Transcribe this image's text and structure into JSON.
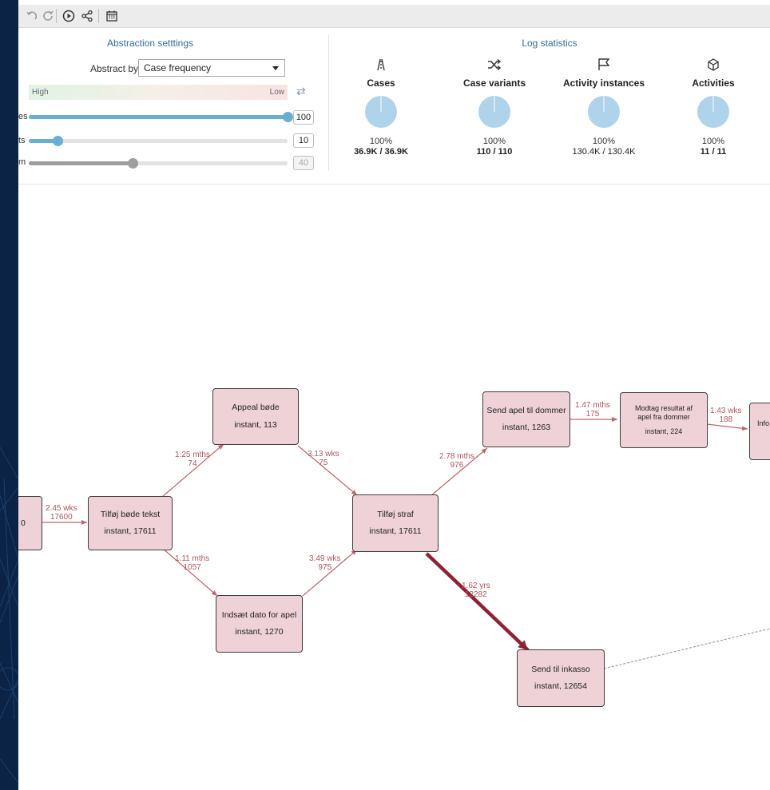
{
  "toolbar": {
    "icons": [
      "undo-icon",
      "redo-icon",
      "play-icon",
      "share-icon",
      "calendar-icon"
    ]
  },
  "abstraction": {
    "title": "Abstraction setttings",
    "abstract_by_label": "Abstract by",
    "abstract_by_value": "Case frequency",
    "high_label": "High",
    "low_label": "Low",
    "sliders": [
      {
        "label_fragment": "es",
        "value": "100",
        "level": 1.0,
        "color": "#6aaed0",
        "disabled": false
      },
      {
        "label_fragment": "ts",
        "value": "10",
        "level": 0.11,
        "color": "#6aaed0",
        "disabled": false
      },
      {
        "label_fragment": "m",
        "value": "40",
        "level": 0.4,
        "color": "#9e9e9e",
        "disabled": true
      }
    ]
  },
  "log_statistics": {
    "title": "Log statistics",
    "items": [
      {
        "icon": "road-icon",
        "label": "Cases",
        "percent": "100%",
        "count": "36.9K / 36.9K",
        "bold": true
      },
      {
        "icon": "shuffle-icon",
        "label": "Case variants",
        "percent": "100%",
        "count": "110 / 110",
        "bold": true
      },
      {
        "icon": "flag-icon",
        "label": "Activity instances",
        "percent": "100%",
        "count": "130.4K / 130.4K",
        "bold": false
      },
      {
        "icon": "cube-icon",
        "label": "Activities",
        "percent": "100%",
        "count": "11 / 11",
        "bold": true
      }
    ],
    "pie_color": "#afd3ea"
  },
  "graph": {
    "nodes": [
      {
        "id": "partial-left",
        "name": "",
        "stat": "0"
      },
      {
        "id": "tilfoj-bode-tekst",
        "name": "Tilføj bøde tekst",
        "stat": "instant, 17611"
      },
      {
        "id": "appeal-bode",
        "name": "Appeal bøde",
        "stat": "instant, 113"
      },
      {
        "id": "indsaet-dato",
        "name": "Indsæt dato for apel",
        "stat": "instant, 1270"
      },
      {
        "id": "tilfoj-straf",
        "name": "Tilføj straf",
        "stat": "instant, 17611"
      },
      {
        "id": "send-apel",
        "name": "Send apel til dommer",
        "stat": "instant, 1263"
      },
      {
        "id": "modtag-resultat",
        "name": "Modtag resultat af apel fra dommer",
        "stat": "instant, 224"
      },
      {
        "id": "send-inkasso",
        "name": "Send til inkasso",
        "stat": "instant, 12654"
      },
      {
        "id": "partial-right",
        "name": "Info",
        "stat": ""
      }
    ],
    "edges": [
      {
        "duration": "2.45 wks",
        "count": "17600"
      },
      {
        "duration": "1.25 mths",
        "count": "74"
      },
      {
        "duration": "1.11 mths",
        "count": "1057"
      },
      {
        "duration": "3.13 wks",
        "count": "75"
      },
      {
        "duration": "3.49 wks",
        "count": "975"
      },
      {
        "duration": "2.78 mths",
        "count": "976"
      },
      {
        "duration": "1.47 mths",
        "count": "175"
      },
      {
        "duration": "1.43 wks",
        "count": "188"
      },
      {
        "duration": "1.62 yrs",
        "count": "12282"
      }
    ]
  }
}
